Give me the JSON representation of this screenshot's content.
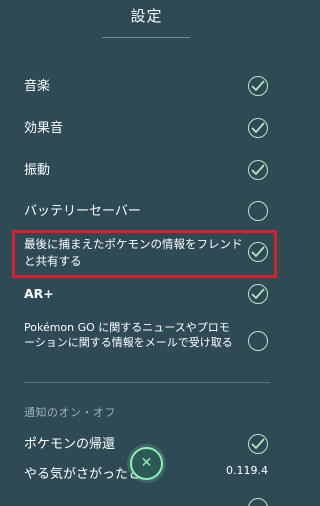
{
  "header": {
    "title": "設定"
  },
  "settings": [
    {
      "label": "音楽",
      "checked": true
    },
    {
      "label": "効果音",
      "checked": true
    },
    {
      "label": "振動",
      "checked": true
    },
    {
      "label": "バッテリーセーバー",
      "checked": false
    },
    {
      "label": "最後に捕まえたポケモンの情報をフレンドと共有する",
      "checked": true
    },
    {
      "label": "AR+",
      "checked": true
    },
    {
      "label": "Pokémon GO に関するニュースやプロモーションに関する情報をメールで受け取る",
      "checked": false
    }
  ],
  "notifications": {
    "heading": "通知のオン・オフ",
    "items": [
      {
        "label": "ポケモンの帰還",
        "checked": true
      },
      {
        "label": "やる気がさがったとき",
        "checked": true
      }
    ]
  },
  "footer": {
    "version": "0.119.4",
    "close_icon": "close-icon"
  },
  "colors": {
    "background": "#2d4a55",
    "check": "#b8eac0",
    "highlight": "#d8202c",
    "accent": "#8ff0b5"
  }
}
